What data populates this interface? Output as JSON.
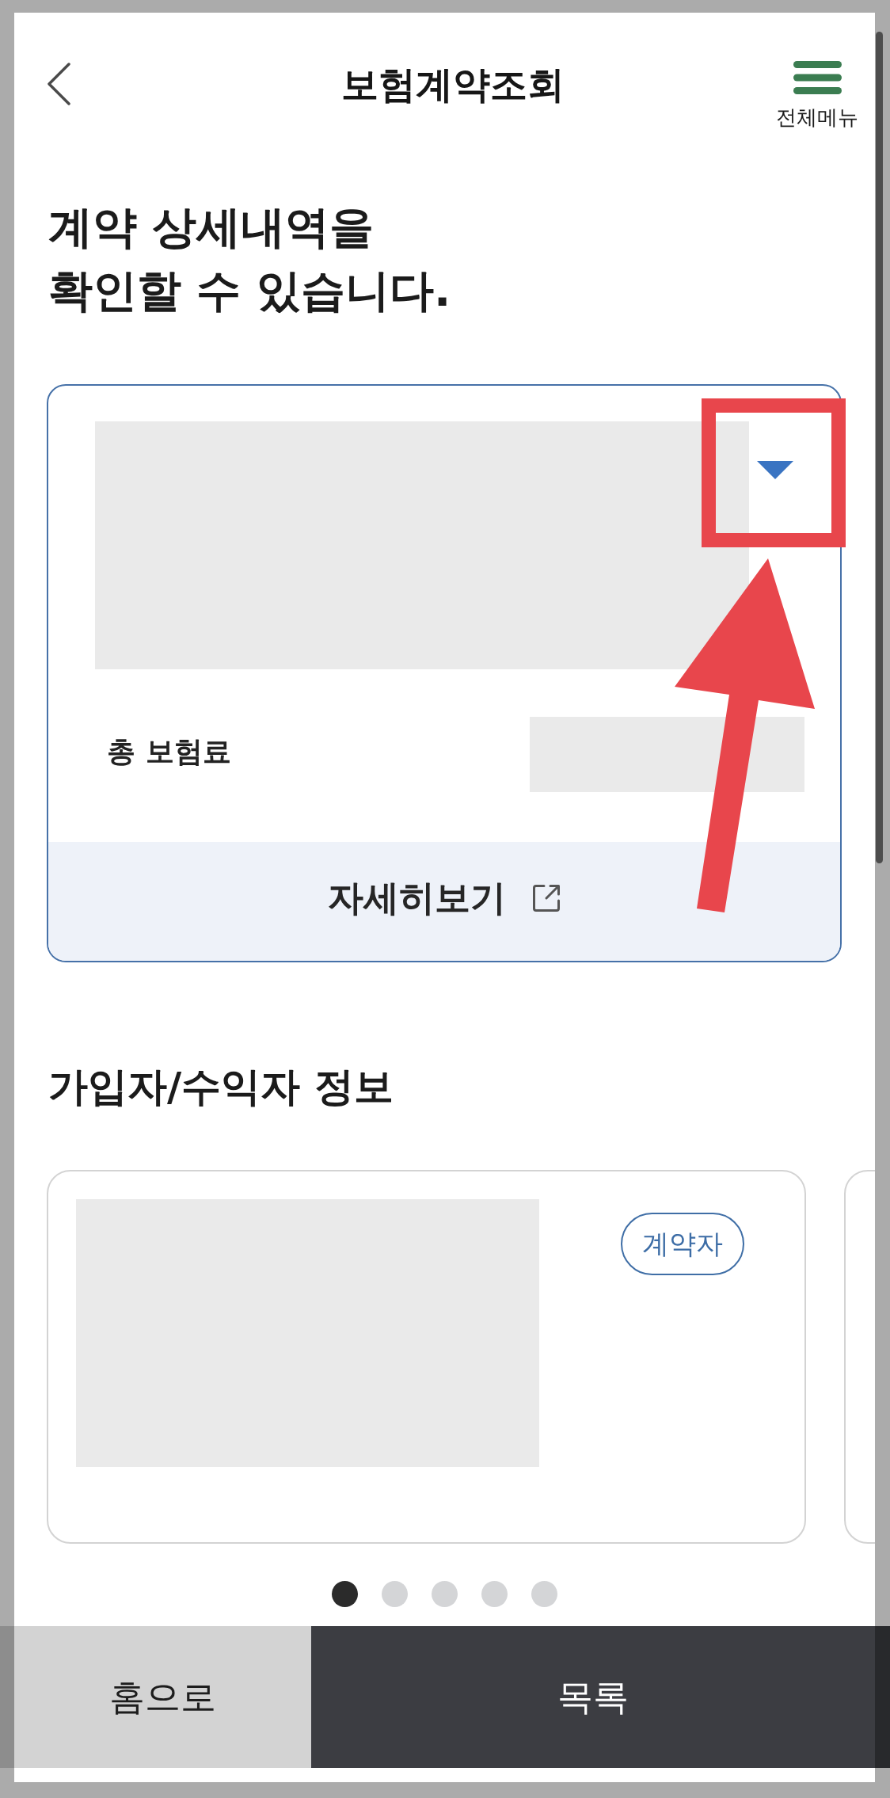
{
  "header": {
    "title": "보험계약조회",
    "menu_label": "전체메뉴"
  },
  "heading": "계약 상세내역을\n확인할 수 있습니다.",
  "contract_card": {
    "expanded": false,
    "premium_label": "총 보험료",
    "details_label": "자세히보기"
  },
  "party_section": {
    "title": "가입자/수익자 정보",
    "cards": [
      {
        "masked": true,
        "badge": "계약자"
      },
      {
        "masked": false
      }
    ],
    "page_dots": [
      {
        "selected": true
      },
      {
        "selected": false
      },
      {
        "selected": false
      },
      {
        "selected": false
      },
      {
        "selected": false
      }
    ]
  },
  "bottom_buttons": [
    {
      "label": "홈으로",
      "kind": "secondary"
    },
    {
      "label": "목록",
      "kind": "primary"
    }
  ]
}
